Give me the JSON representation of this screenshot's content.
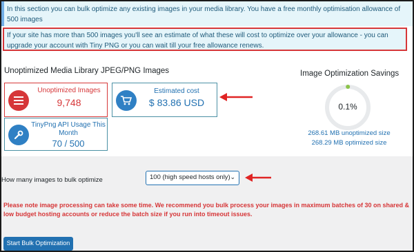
{
  "notices": {
    "info": "In this section you can bulk optimize any existing images in your media library. You have a free monthly optimisation allowance of 500 images",
    "estimate": "If your site has more than 500 images you'll see an estimate of what these will cost to optimize over your allowance - you can upgrade your account with Tiny PNG or you can wait till your free allowance renews."
  },
  "section_title": "Unoptimized Media Library JPEG/PNG Images",
  "cards": {
    "unoptimized": {
      "label": "Unoptimized Images",
      "value": "9,748",
      "icon": "list-icon"
    },
    "cost": {
      "label": "Estimated cost",
      "value": "$ 83.86 USD",
      "icon": "cart-icon"
    },
    "api": {
      "label": "TinyPng API Usage This Month",
      "value": "70 / 500",
      "icon": "wrench-icon"
    }
  },
  "savings": {
    "title": "Image Optimization Savings",
    "percent_label": "0.1%",
    "percent": 0.1,
    "unoptimized_size": "268.61 MB unoptimized size",
    "optimized_size": "268.29 MB optimized size"
  },
  "bulk": {
    "label": "How many images to bulk optimize",
    "selected": "100 (high speed hosts only)"
  },
  "warning": "Please note image processing can take some time. We recommend you bulk process your images in maximum batches of 30 on shared & low budget hosting accounts or reduce the batch size if you run into timeout issues.",
  "start_button": "Start Bulk Optimization",
  "colors": {
    "accent": "#2271b1",
    "danger": "#d63638",
    "donut_track": "#e8eaec",
    "donut_fill": "#8bc34a",
    "annotation_arrow": "#e02424"
  }
}
